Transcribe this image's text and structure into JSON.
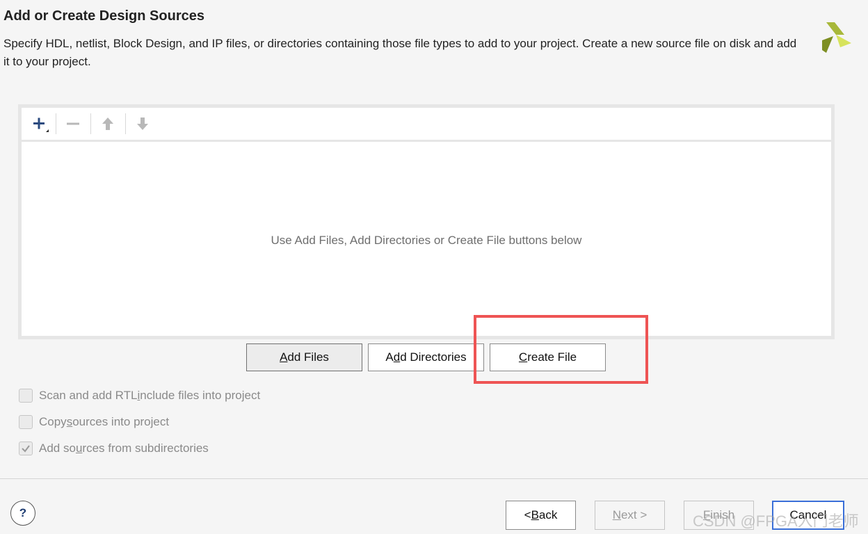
{
  "header": {
    "title": "Add or Create Design Sources",
    "description": "Specify HDL, netlist, Block Design, and IP files, or directories containing those file types to add to your project. Create a new source file on disk and add it to your project.",
    "logo_icon": "vivado-logo-icon"
  },
  "toolbar": {
    "add_icon": "plus-icon",
    "remove_icon": "minus-icon",
    "move_up_icon": "arrow-up-icon",
    "move_down_icon": "arrow-down-icon"
  },
  "file_list": {
    "empty_message": "Use Add Files, Add Directories or Create File buttons below"
  },
  "actions": {
    "add_files": {
      "pre": "",
      "key": "A",
      "post": "dd Files"
    },
    "add_directories": {
      "pre": "A",
      "key": "d",
      "post": "d Directories"
    },
    "create_file": {
      "pre": "",
      "key": "C",
      "post": "reate File"
    }
  },
  "options": [
    {
      "pre": "Scan and add RTL ",
      "key": "i",
      "post": "nclude files into project",
      "checked": false
    },
    {
      "pre": "Copy ",
      "key": "s",
      "post": "ources into project",
      "checked": false
    },
    {
      "pre": "Add so",
      "key": "u",
      "post": "rces from subdirectories",
      "checked": true
    }
  ],
  "footer": {
    "help_label": "?",
    "back": {
      "pre": "< ",
      "key": "B",
      "post": "ack"
    },
    "next": {
      "pre": "",
      "key": "N",
      "post": "ext >"
    },
    "finish": {
      "pre": "",
      "key": "F",
      "post": "inish"
    },
    "cancel": {
      "pre": "",
      "key": "",
      "post": "Cancel"
    }
  },
  "watermark": "CSDN @FPGA入门老师",
  "colors": {
    "highlight": "#ee5454",
    "accent": "#3a6fd8",
    "logo_dark": "#8a9a2a",
    "logo_light": "#d7e35c"
  }
}
